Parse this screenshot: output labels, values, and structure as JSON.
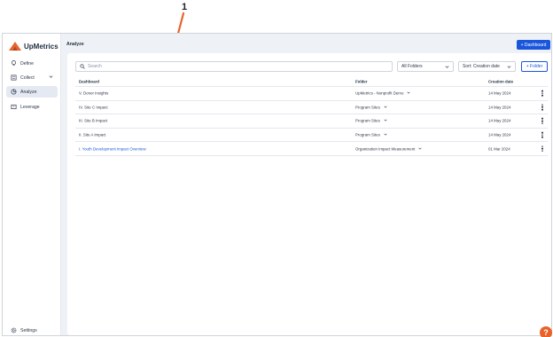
{
  "annotation": {
    "number": "1"
  },
  "app": {
    "logo_text": "UpMetrics"
  },
  "sidebar": {
    "items": [
      {
        "label": "Define",
        "icon": "lightbulb-icon"
      },
      {
        "label": "Collect",
        "icon": "collect-icon"
      },
      {
        "label": "Analyze",
        "icon": "analyze-icon"
      },
      {
        "label": "Leverage",
        "icon": "leverage-icon"
      }
    ],
    "settings_label": "Settings"
  },
  "header": {
    "title": "Analyze",
    "dashboard_button": "+ Dashboard"
  },
  "toolbar": {
    "search_placeholder": "Search",
    "folders_select": "All Folders",
    "sort_select": "Sort: Creation date",
    "folder_button": "+ Folder"
  },
  "table": {
    "columns": [
      "Dashboard",
      "Folder",
      "Creation date"
    ],
    "rows": [
      {
        "name": "V. Donor Insights",
        "folder": "UpMetrics - Nonprofit Demo",
        "date": "14 May 2024"
      },
      {
        "name": "IV. Site C Impact",
        "folder": "Program Sites",
        "date": "14 May 2024"
      },
      {
        "name": "III. Site B Impact",
        "folder": "Program Sites",
        "date": "14 May 2024"
      },
      {
        "name": "II. Site A Impact",
        "folder": "Program Sites",
        "date": "14 May 2024"
      },
      {
        "name": "I. Youth Development Impact Overview",
        "folder": "Organization Impact Measurement",
        "date": "01 Mar 2024"
      }
    ]
  },
  "colors": {
    "accent": "#1a56db",
    "annotation": "#e8632b",
    "help": "#e8632b"
  }
}
